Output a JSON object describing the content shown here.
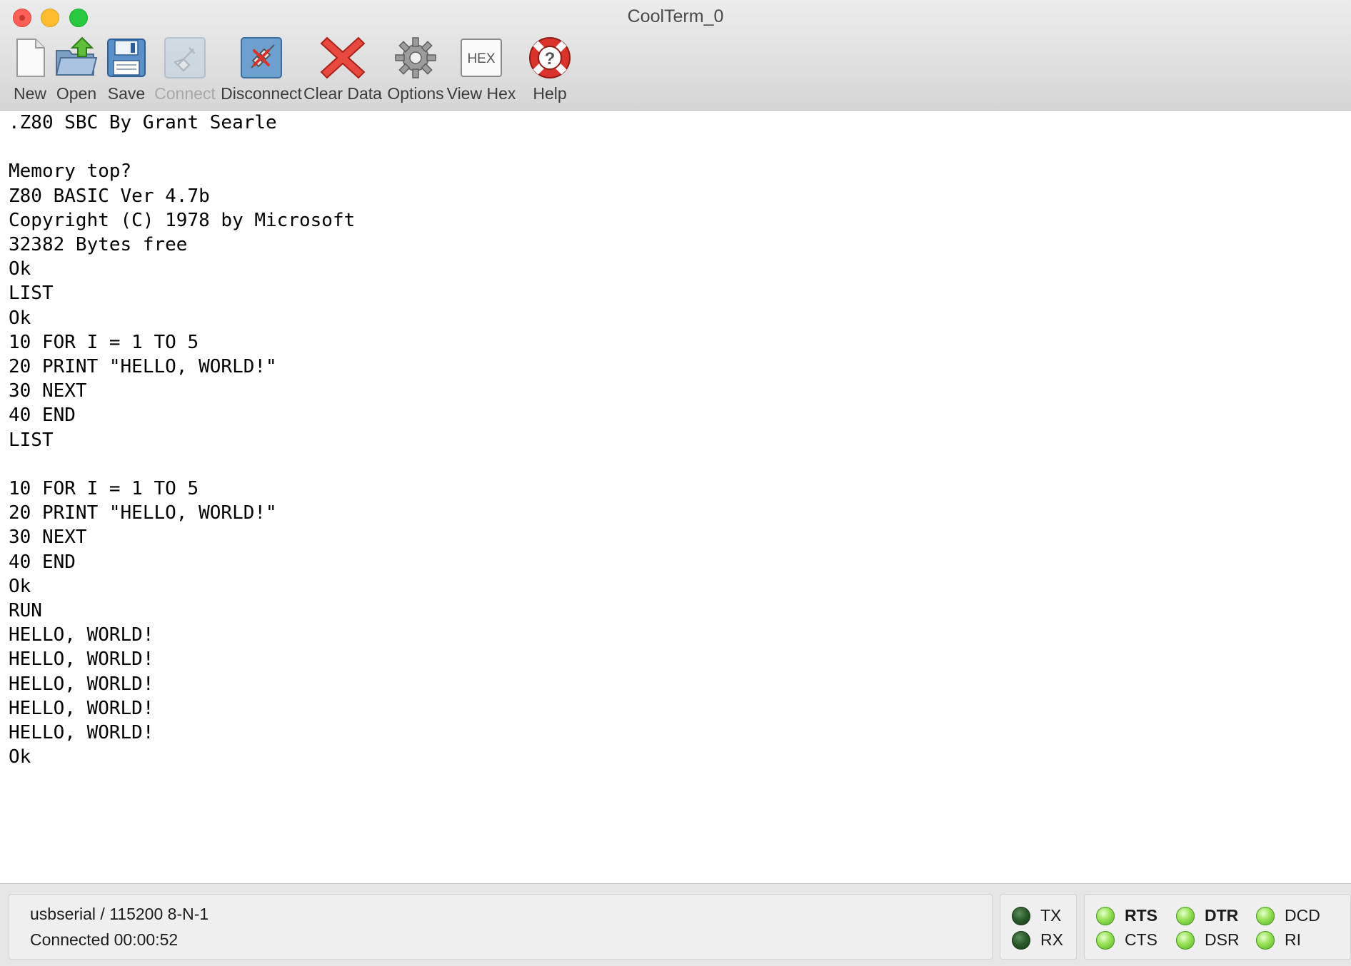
{
  "window": {
    "title": "CoolTerm_0"
  },
  "toolbar": {
    "items": [
      {
        "label": "New",
        "icon": "new-file-icon",
        "enabled": true
      },
      {
        "label": "Open",
        "icon": "open-folder-icon",
        "enabled": true
      },
      {
        "label": "Save",
        "icon": "save-disk-icon",
        "enabled": true
      },
      {
        "label": "Connect",
        "icon": "connect-plug-icon",
        "enabled": false
      },
      {
        "label": "Disconnect",
        "icon": "disconnect-plug-icon",
        "enabled": true
      },
      {
        "label": "Clear Data",
        "icon": "clear-x-icon",
        "enabled": true
      },
      {
        "label": "Options",
        "icon": "gear-icon",
        "enabled": true
      },
      {
        "label": "View Hex",
        "icon": "hex-icon",
        "enabled": true
      },
      {
        "label": "Help",
        "icon": "lifebuoy-help-icon",
        "enabled": true
      }
    ],
    "hex_icon_text": "HEX"
  },
  "terminal": {
    "lines": [
      ".Z80 SBC By Grant Searle",
      "",
      "Memory top?",
      "Z80 BASIC Ver 4.7b",
      "Copyright (C) 1978 by Microsoft",
      "32382 Bytes free",
      "Ok",
      "LIST",
      "Ok",
      "10 FOR I = 1 TO 5",
      "20 PRINT \"HELLO, WORLD!\"",
      "30 NEXT",
      "40 END",
      "LIST",
      "",
      "10 FOR I = 1 TO 5",
      "20 PRINT \"HELLO, WORLD!\"",
      "30 NEXT",
      "40 END",
      "Ok",
      "RUN",
      "HELLO, WORLD!",
      "HELLO, WORLD!",
      "HELLO, WORLD!",
      "HELLO, WORLD!",
      "HELLO, WORLD!",
      "Ok"
    ]
  },
  "status": {
    "port_settings": "usbserial / 115200 8-N-1",
    "connection": "Connected 00:00:52",
    "tx_label": "TX",
    "rx_label": "RX",
    "rts_label": "RTS",
    "cts_label": "CTS",
    "dtr_label": "DTR",
    "dsr_label": "DSR",
    "dcd_label": "DCD",
    "ri_label": "RI",
    "indicators": {
      "TX": "dark",
      "RX": "dark",
      "RTS": "bright",
      "CTS": "bright",
      "DTR": "bright",
      "DSR": "bright",
      "DCD": "bright",
      "RI": "bright"
    }
  },
  "colors": {
    "led_dark": "#2a5a2a",
    "led_bright": "#7ed23c",
    "close": "#fe5f57",
    "minimize": "#febc2e",
    "zoom": "#28c840"
  }
}
